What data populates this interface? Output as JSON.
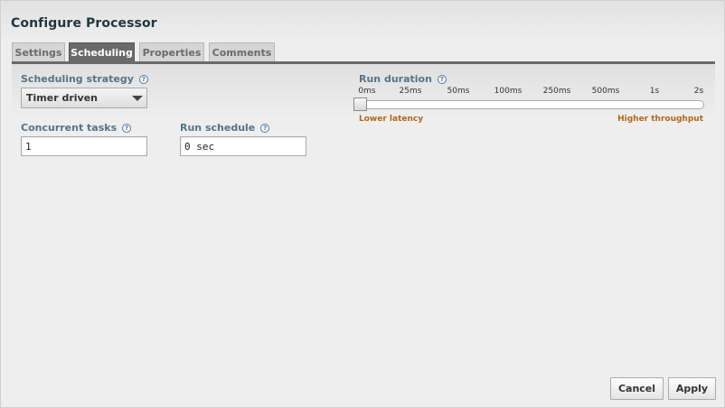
{
  "dialog": {
    "title": "Configure Processor"
  },
  "tabs": [
    {
      "label": "Settings"
    },
    {
      "label": "Scheduling",
      "active": true
    },
    {
      "label": "Properties"
    },
    {
      "label": "Comments"
    }
  ],
  "scheduling": {
    "strategy_label": "Scheduling strategy",
    "strategy_value": "Timer driven",
    "concurrent_label": "Concurrent tasks",
    "concurrent_value": "1",
    "schedule_label": "Run schedule",
    "schedule_value": "0 sec",
    "help_glyph": "?"
  },
  "run_duration": {
    "label": "Run duration",
    "ticks": [
      "0ms",
      "25ms",
      "50ms",
      "100ms",
      "250ms",
      "500ms",
      "1s",
      "2s"
    ],
    "selected": "0ms",
    "low_label": "Lower latency",
    "high_label": "Higher throughput"
  },
  "buttons": {
    "cancel": "Cancel",
    "apply": "Apply"
  },
  "colors": {
    "label": "#547485",
    "accent_orange": "#b0671a",
    "active_tab": "#6a6a6a",
    "title": "#1e373f"
  },
  "icons": {
    "help": "help-icon",
    "dropdown": "chevron-down-icon"
  }
}
